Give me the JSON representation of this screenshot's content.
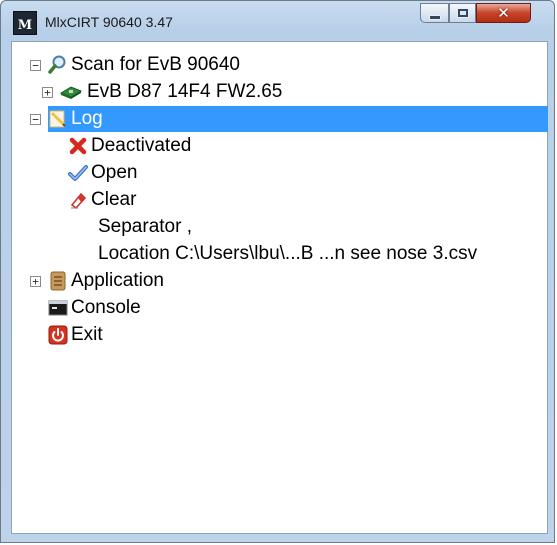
{
  "window": {
    "title": "MlxCIRT 90640 3.47",
    "icon_letter": "M"
  },
  "tree": {
    "scan": {
      "label": "Scan for EvB 90640",
      "expander": "−",
      "icon": "magnifier-icon"
    },
    "device": {
      "label": "EvB D87 14F4 FW2.65",
      "expander": "+",
      "icon": "board-icon"
    },
    "log": {
      "label": "Log",
      "expander": "−",
      "icon": "pencil-log-icon",
      "selected": true
    },
    "log_children": {
      "deactivated": {
        "label": "Deactivated",
        "icon": "red-x-icon"
      },
      "open": {
        "label": "Open",
        "icon": "checkmark-icon"
      },
      "clear": {
        "label": "Clear",
        "icon": "eraser-icon"
      },
      "separator": {
        "label": "Separator ,"
      },
      "location": {
        "label": "Location C:\\Users\\lbu\\...B ...n see nose 3.csv"
      }
    },
    "application": {
      "label": "Application",
      "expander": "+",
      "icon": "book-icon"
    },
    "console": {
      "label": "Console",
      "icon": "console-icon"
    },
    "exit": {
      "label": "Exit",
      "icon": "power-icon"
    }
  },
  "colors": {
    "selection": "#3399ff",
    "close_button": "#c7442b"
  }
}
